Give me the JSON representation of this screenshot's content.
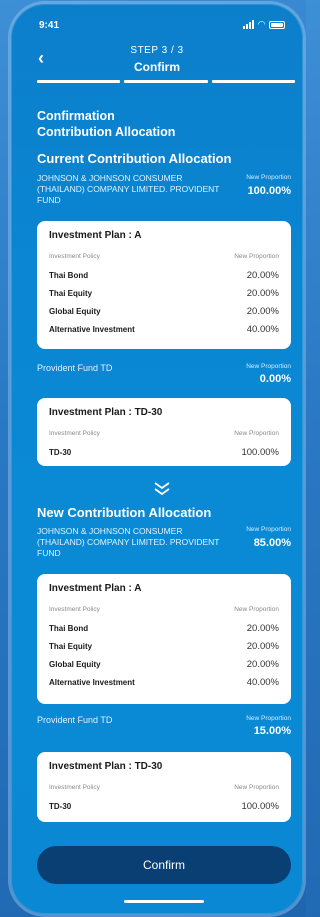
{
  "status_bar": {
    "time": "9:41"
  },
  "header": {
    "step": "STEP 3 / 3",
    "title": "Confirm",
    "back_icon": "chevron-left-icon"
  },
  "section": {
    "line1": "Confirmation",
    "line2": "Contribution Allocation"
  },
  "current": {
    "heading": "Current Contribution Allocation",
    "company": "JOHNSON & JOHNSON CONSUMER (THAILAND) COMPANY LIMITED. PROVIDENT FUND",
    "np_label": "New Proportion",
    "np_value": "100.00%",
    "plan_card": {
      "plan": "Investment Plan :  A",
      "policy_label": "Investment Policy",
      "np_label": "New Proportion",
      "rows": [
        {
          "name": "Thai Bond",
          "pct": "20.00%"
        },
        {
          "name": "Thai Equity",
          "pct": "20.00%"
        },
        {
          "name": "Global Equity",
          "pct": "20.00%"
        },
        {
          "name": "Alternative Investment",
          "pct": "40.00%"
        }
      ]
    },
    "fund_td": {
      "label": "Provident Fund TD",
      "np_label": "New Proportion",
      "np_value": "0.00%"
    },
    "td_card": {
      "plan": "Investment Plan :  TD-30",
      "policy_label": "Investment Policy",
      "np_label": "New Proportion",
      "rows": [
        {
          "name": "TD-30",
          "pct": "100.00%"
        }
      ]
    }
  },
  "new": {
    "heading": "New Contribution Allocation",
    "company": "JOHNSON & JOHNSON CONSUMER (THAILAND) COMPANY LIMITED. PROVIDENT FUND",
    "np_label": "New Proportion",
    "np_value": "85.00%",
    "plan_card": {
      "plan": "Investment Plan :  A",
      "policy_label": "Investment Policy",
      "np_label": "New Proportion",
      "rows": [
        {
          "name": "Thai Bond",
          "pct": "20.00%"
        },
        {
          "name": "Thai Equity",
          "pct": "20.00%"
        },
        {
          "name": "Global Equity",
          "pct": "20.00%"
        },
        {
          "name": "Alternative Investment",
          "pct": "40.00%"
        }
      ]
    },
    "fund_td": {
      "label": "Provident Fund TD",
      "np_label": "New Proportion",
      "np_value": "15.00%"
    },
    "td_card": {
      "plan": "Investment Plan :  TD-30",
      "policy_label": "Investment Policy",
      "np_label": "New Proportion",
      "rows": [
        {
          "name": "TD-30",
          "pct": "100.00%"
        }
      ]
    }
  },
  "confirm_button": "Confirm",
  "colors": {
    "background": "#0a88d3",
    "button": "#0a3f73",
    "card": "#ffffff"
  }
}
